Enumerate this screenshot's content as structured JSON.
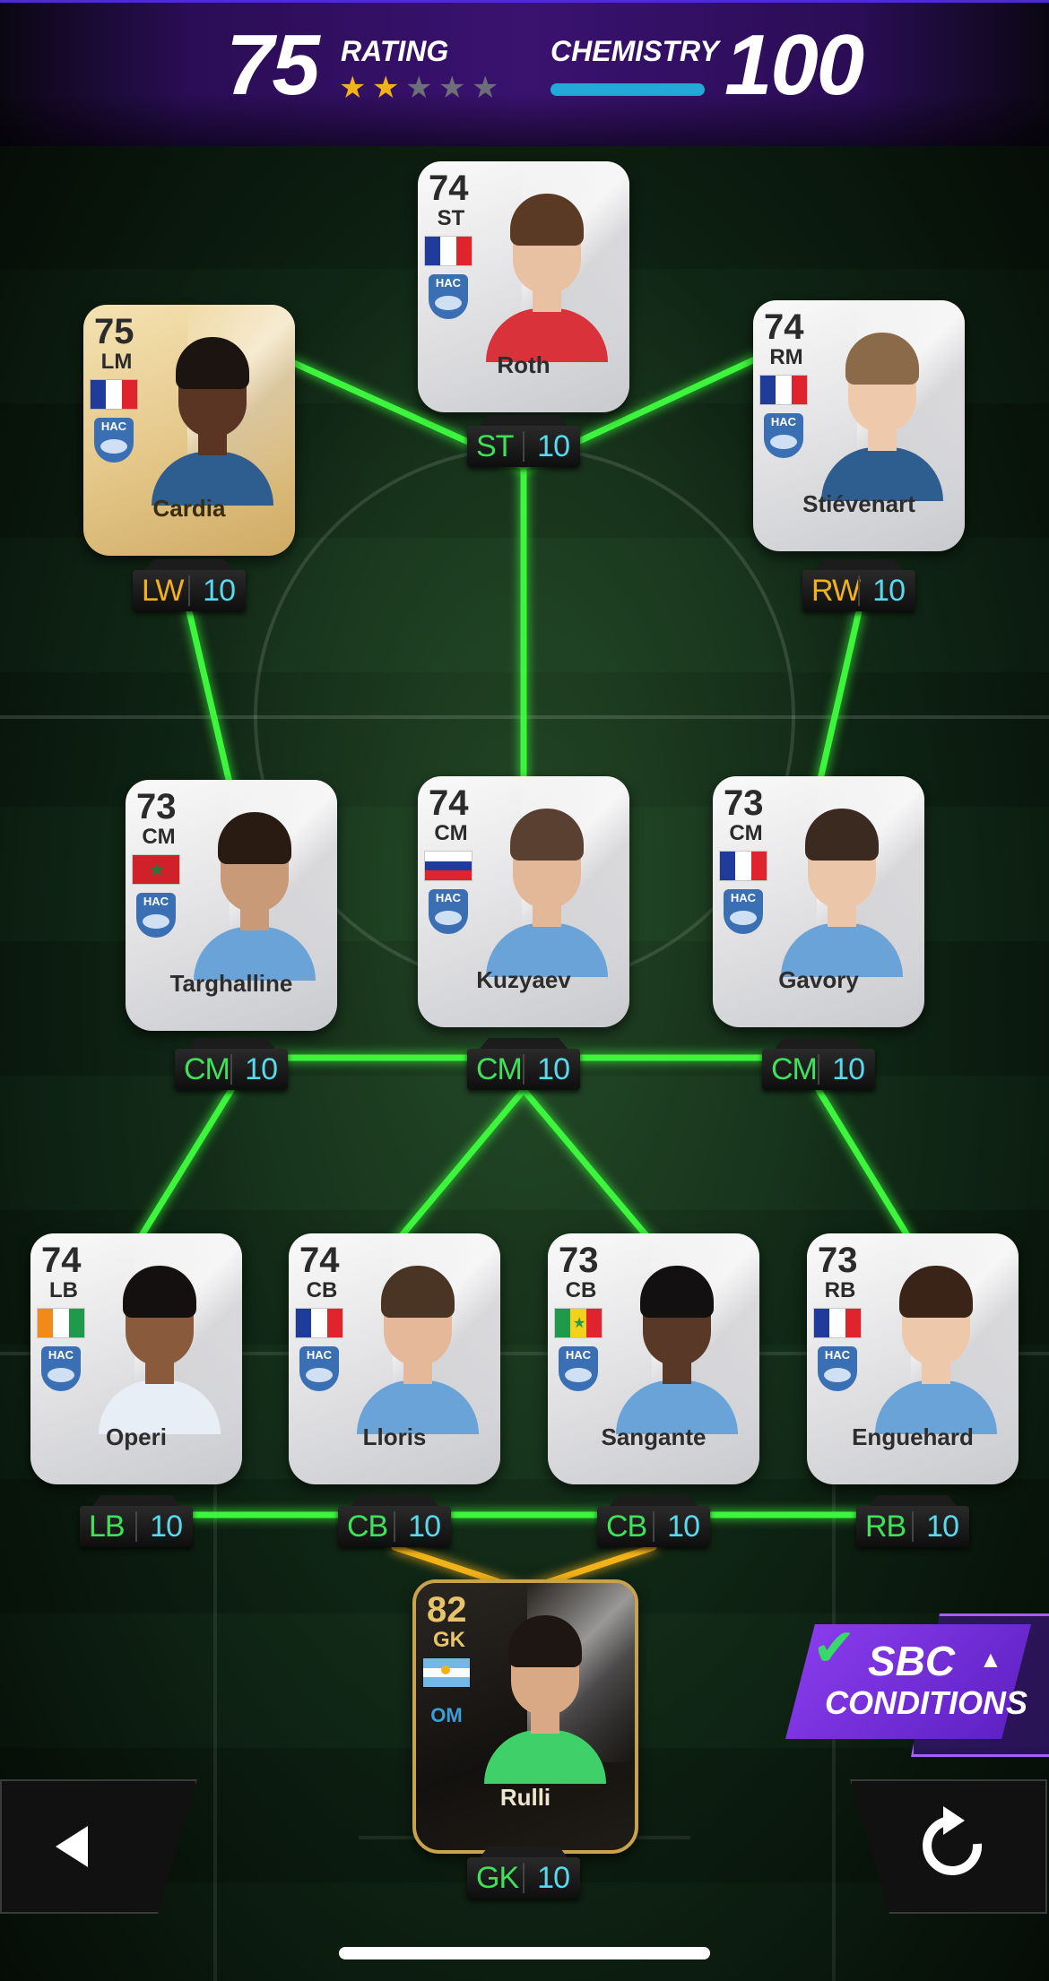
{
  "header": {
    "rating_value": "75",
    "rating_label": "RATING",
    "stars_filled": 2,
    "stars_total": 5,
    "chemistry_label": "CHEMISTRY",
    "chemistry_value": "100",
    "chemistry_fill": 1.0
  },
  "colors": {
    "link_green": "#3df53d",
    "link_gold": "#f2b21a",
    "chem_green": "#3fe05a",
    "chem_gold": "#f2b21a",
    "chem_cyan": "#57d9ee",
    "header_purple": "#3a1270"
  },
  "players": [
    {
      "id": "st",
      "rating": "74",
      "position": "ST",
      "name": "Roth",
      "nation": "france",
      "club": "HAC",
      "card": "silver",
      "chem_pos": "ST",
      "chem_val": "10",
      "pos_color": "green",
      "skin": "#e8c1a3",
      "hair": "#5a3a25",
      "shirt": "#d9323a"
    },
    {
      "id": "lw",
      "rating": "75",
      "position": "LM",
      "name": "Cardia",
      "nation": "france",
      "club": "HAC",
      "card": "gold",
      "chem_pos": "LW",
      "chem_val": "10",
      "pos_color": "gold",
      "skin": "#5a3524",
      "hair": "#1c1410",
      "shirt": "#2e5d8f"
    },
    {
      "id": "rw",
      "rating": "74",
      "position": "RM",
      "name": "Stiévenart",
      "nation": "france",
      "club": "HAC",
      "card": "silver",
      "chem_pos": "RW",
      "chem_val": "10",
      "pos_color": "gold",
      "skin": "#eec9ac",
      "hair": "#8a6a48",
      "shirt": "#2e5d8f"
    },
    {
      "id": "lcm",
      "rating": "73",
      "position": "CM",
      "name": "Targhalline",
      "nation": "morocco",
      "club": "HAC",
      "card": "silver",
      "chem_pos": "CM",
      "chem_val": "10",
      "pos_color": "green",
      "skin": "#c89a78",
      "hair": "#2a1b12",
      "shirt": "#6aa3d8"
    },
    {
      "id": "ccm",
      "rating": "74",
      "position": "CM",
      "name": "Kuzyaev",
      "nation": "russia",
      "club": "HAC",
      "card": "silver",
      "chem_pos": "CM",
      "chem_val": "10",
      "pos_color": "green",
      "skin": "#e2b898",
      "hair": "#5a4030",
      "shirt": "#6aa3d8"
    },
    {
      "id": "rcm",
      "rating": "73",
      "position": "CM",
      "name": "Gavory",
      "nation": "france",
      "club": "HAC",
      "card": "silver",
      "chem_pos": "CM",
      "chem_val": "10",
      "pos_color": "green",
      "skin": "#ecc6a8",
      "hair": "#3a2a20",
      "shirt": "#6aa3d8"
    },
    {
      "id": "lb",
      "rating": "74",
      "position": "LB",
      "name": "Operi",
      "nation": "ivory-coast",
      "club": "HAC",
      "card": "silver",
      "chem_pos": "LB",
      "chem_val": "10",
      "pos_color": "green",
      "skin": "#8a5a3c",
      "hair": "#141010",
      "shirt": "#e8eef5"
    },
    {
      "id": "lcb",
      "rating": "74",
      "position": "CB",
      "name": "Lloris",
      "nation": "france",
      "club": "HAC",
      "card": "silver",
      "chem_pos": "CB",
      "chem_val": "10",
      "pos_color": "green",
      "skin": "#e4b898",
      "hair": "#4a3424",
      "shirt": "#6aa3d8"
    },
    {
      "id": "rcb",
      "rating": "73",
      "position": "CB",
      "name": "Sangante",
      "nation": "senegal",
      "club": "HAC",
      "card": "silver",
      "chem_pos": "CB",
      "chem_val": "10",
      "pos_color": "green",
      "skin": "#5a3828",
      "hair": "#121010",
      "shirt": "#6aa3d8"
    },
    {
      "id": "rb",
      "rating": "73",
      "position": "RB",
      "name": "Enguehard",
      "nation": "france",
      "club": "HAC",
      "card": "silver",
      "chem_pos": "RB",
      "chem_val": "10",
      "pos_color": "green",
      "skin": "#eec8aa",
      "hair": "#3a2418",
      "shirt": "#6aa3d8"
    },
    {
      "id": "gk",
      "rating": "82",
      "position": "GK",
      "name": "Rulli",
      "nation": "argentina",
      "club": "OM",
      "card": "black",
      "chem_pos": "GK",
      "chem_val": "10",
      "pos_color": "green",
      "skin": "#d9a884",
      "hair": "#1e1612",
      "shirt": "#3fd06a"
    }
  ],
  "links": [
    {
      "from": "lw",
      "to": "st",
      "color": "green"
    },
    {
      "from": "st",
      "to": "rw",
      "color": "green"
    },
    {
      "from": "st",
      "to": "ccm",
      "color": "green"
    },
    {
      "from": "lw",
      "to": "lcm",
      "color": "green"
    },
    {
      "from": "rw",
      "to": "rcm",
      "color": "green"
    },
    {
      "from": "lcm",
      "to": "ccm",
      "color": "green"
    },
    {
      "from": "ccm",
      "to": "rcm",
      "color": "green"
    },
    {
      "from": "lcm",
      "to": "lb",
      "color": "green"
    },
    {
      "from": "ccm",
      "to": "lcb",
      "color": "green"
    },
    {
      "from": "ccm",
      "to": "rcb",
      "color": "green"
    },
    {
      "from": "rcm",
      "to": "rb",
      "color": "green"
    },
    {
      "from": "lb",
      "to": "lcb",
      "color": "green"
    },
    {
      "from": "lcb",
      "to": "rcb",
      "color": "green"
    },
    {
      "from": "rcb",
      "to": "rb",
      "color": "green"
    },
    {
      "from": "lcb",
      "to": "gk",
      "color": "gold"
    },
    {
      "from": "rcb",
      "to": "gk",
      "color": "gold"
    }
  ],
  "sbc": {
    "line1": "SBC",
    "line2": "CONDITIONS",
    "icon": "check-icon",
    "chevron": "chevron-up-icon"
  },
  "controls": {
    "back_icon": "back-arrow-icon",
    "reset_icon": "reset-icon"
  }
}
